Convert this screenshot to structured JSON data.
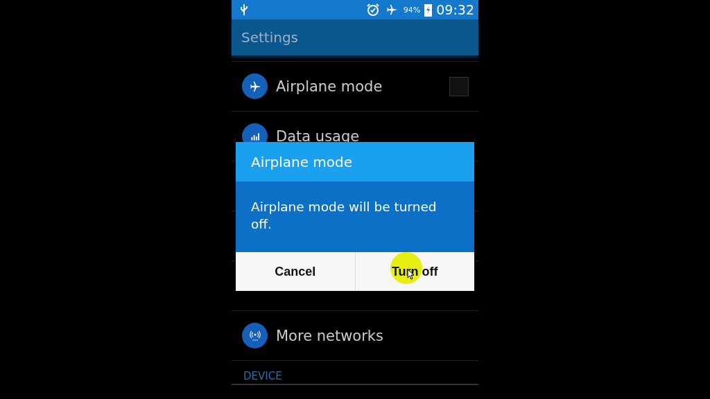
{
  "status_bar": {
    "battery": "94%",
    "time": "09:32"
  },
  "action_bar": {
    "title": "Settings"
  },
  "settings": [
    {
      "kind": "airplane",
      "label": "Airplane mode",
      "checked": false
    },
    {
      "kind": "data",
      "label": "Data usage"
    },
    {
      "kind": "covered"
    },
    {
      "kind": "covered"
    },
    {
      "kind": "covered"
    },
    {
      "kind": "networks",
      "label": "More networks"
    }
  ],
  "section_header": "DEVICE",
  "dialog": {
    "title": "Airplane mode",
    "message": "Airplane mode will be turned off.",
    "buttons": [
      {
        "label": "Cancel",
        "pressed": false
      },
      {
        "label": "Turn off",
        "pressed": true
      }
    ]
  }
}
